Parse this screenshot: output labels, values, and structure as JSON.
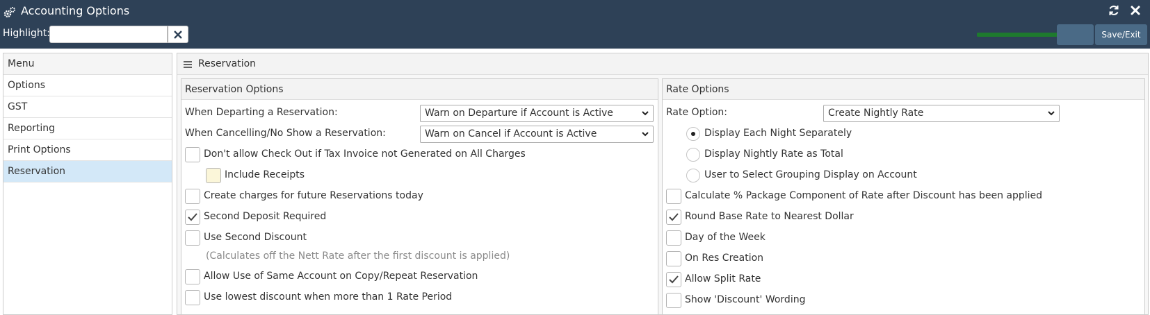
{
  "window": {
    "title": "Accounting Options",
    "highlight_label": "Highlight:",
    "highlight_value": "",
    "save_exit_label": "Save/Exit"
  },
  "menu": {
    "header": "Menu",
    "items": [
      {
        "label": "Options"
      },
      {
        "label": "GST"
      },
      {
        "label": "Reporting"
      },
      {
        "label": "Print Options"
      },
      {
        "label": "Reservation"
      }
    ],
    "active": "Reservation"
  },
  "main": {
    "title": "Reservation",
    "reservation_options": {
      "title": "Reservation Options",
      "departing_label": "When Departing a Reservation:",
      "departing_value": "Warn on Departure if Account is Active",
      "cancelling_label": "When Cancelling/No Show a Reservation:",
      "cancelling_value": "Warn on Cancel if Account is Active",
      "checkboxes": [
        {
          "label": "Don't allow Check Out if Tax Invoice not Generated on All Charges",
          "checked": false
        },
        {
          "label": "Include Receipts",
          "checked": false
        },
        {
          "label": "Create charges for future Reservations today",
          "checked": false
        },
        {
          "label": "Second Deposit Required",
          "checked": true
        },
        {
          "label": "Use Second Discount",
          "checked": false
        },
        {
          "label": "Allow Use of Same Account on Copy/Repeat Reservation",
          "checked": false
        },
        {
          "label": "Use lowest discount when more than 1 Rate Period",
          "checked": false
        }
      ],
      "second_discount_note": "(Calculates off the Nett Rate after the first discount is applied)"
    },
    "rate_options": {
      "title": "Rate Options",
      "rate_option_label": "Rate Option:",
      "rate_option_value": "Create Nightly Rate",
      "radios": [
        {
          "label": "Display Each Night Separately",
          "selected": true
        },
        {
          "label": "Display Nightly Rate as Total",
          "selected": false
        },
        {
          "label": "User to Select Grouping Display on Account",
          "selected": false
        }
      ],
      "checkboxes": [
        {
          "label": "Calculate % Package Component of Rate after Discount has been applied",
          "checked": false
        },
        {
          "label": "Round Base Rate to Nearest Dollar",
          "checked": true
        },
        {
          "label": "Day of the Week",
          "checked": false
        },
        {
          "label": "On Res Creation",
          "checked": false
        },
        {
          "label": "Allow Split Rate",
          "checked": true
        },
        {
          "label": "Show 'Discount' Wording",
          "checked": false
        }
      ]
    }
  },
  "colors": {
    "titlebar": "#2e4157",
    "button": "#4a6a86",
    "active_menu": "#d3e8f8",
    "arrow": "#1e7a2e"
  }
}
